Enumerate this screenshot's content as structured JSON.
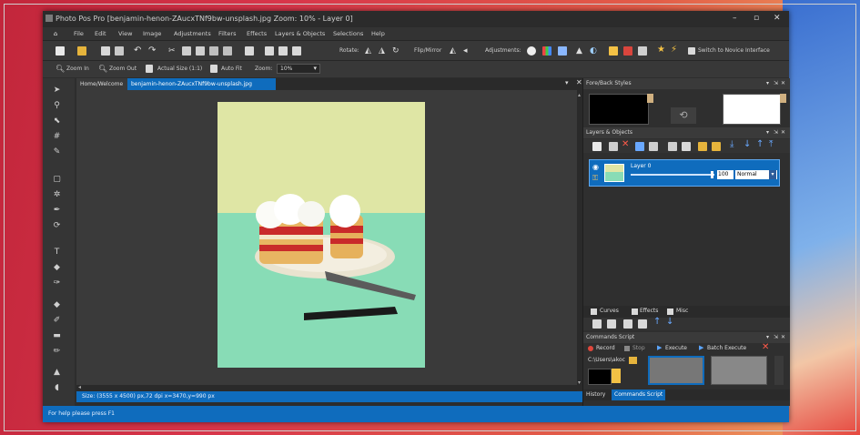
{
  "window": {
    "title": "Photo Pos Pro [benjamin-henon-ZAucxTNf9bw-unsplash.jpg Zoom: 10% - Layer 0]",
    "controls": [
      "–",
      "▫",
      "✕"
    ]
  },
  "menu": {
    "items": [
      "File",
      "Edit",
      "View",
      "Image",
      "Adjustments",
      "Filters",
      "Effects",
      "Layers & Objects",
      "Selections",
      "Help"
    ]
  },
  "toolbar": {
    "rotate_label": "Rotate:",
    "flip_label": "Flip/Mirror",
    "adjustments_label": "Adjustments:",
    "novice_label": "Switch to Novice Interface"
  },
  "zoombar": {
    "zoom_in": "Zoom In",
    "zoom_out": "Zoom Out",
    "actual_size": "Actual Size (1:1)",
    "auto_fit": "Auto Fit",
    "zoom_label": "Zoom:",
    "zoom_value": "10%"
  },
  "tabs": [
    {
      "label": "Home/Welcome"
    },
    {
      "label": "benjamin-henon-ZAucxTNf9bw-unsplash.jpg"
    }
  ],
  "status": {
    "image_info": "Size: (3555 x 4500) px,72 dpi  x=3470,y=990 px",
    "help": "For help please press F1"
  },
  "panels": {
    "foreback": {
      "title": "Fore/Back Styles"
    },
    "layers": {
      "title": "Layers & Objects",
      "layer_name": "Layer 0",
      "opacity": "100",
      "blend": "Normal",
      "tabs": [
        "Curves",
        "Effects",
        "Misc"
      ]
    },
    "commands": {
      "title": "Commands Script",
      "record": "Record",
      "stop": "Stop",
      "execute": "Execute",
      "batch": "Batch Execute",
      "path": "C:\\Users\\akoc",
      "bottom_tabs": [
        "History",
        "Commands Script"
      ]
    }
  },
  "colors": {
    "accent": "#0f6cbd",
    "photo_top": "#dfe6a5",
    "photo_bottom": "#88dcb6"
  }
}
